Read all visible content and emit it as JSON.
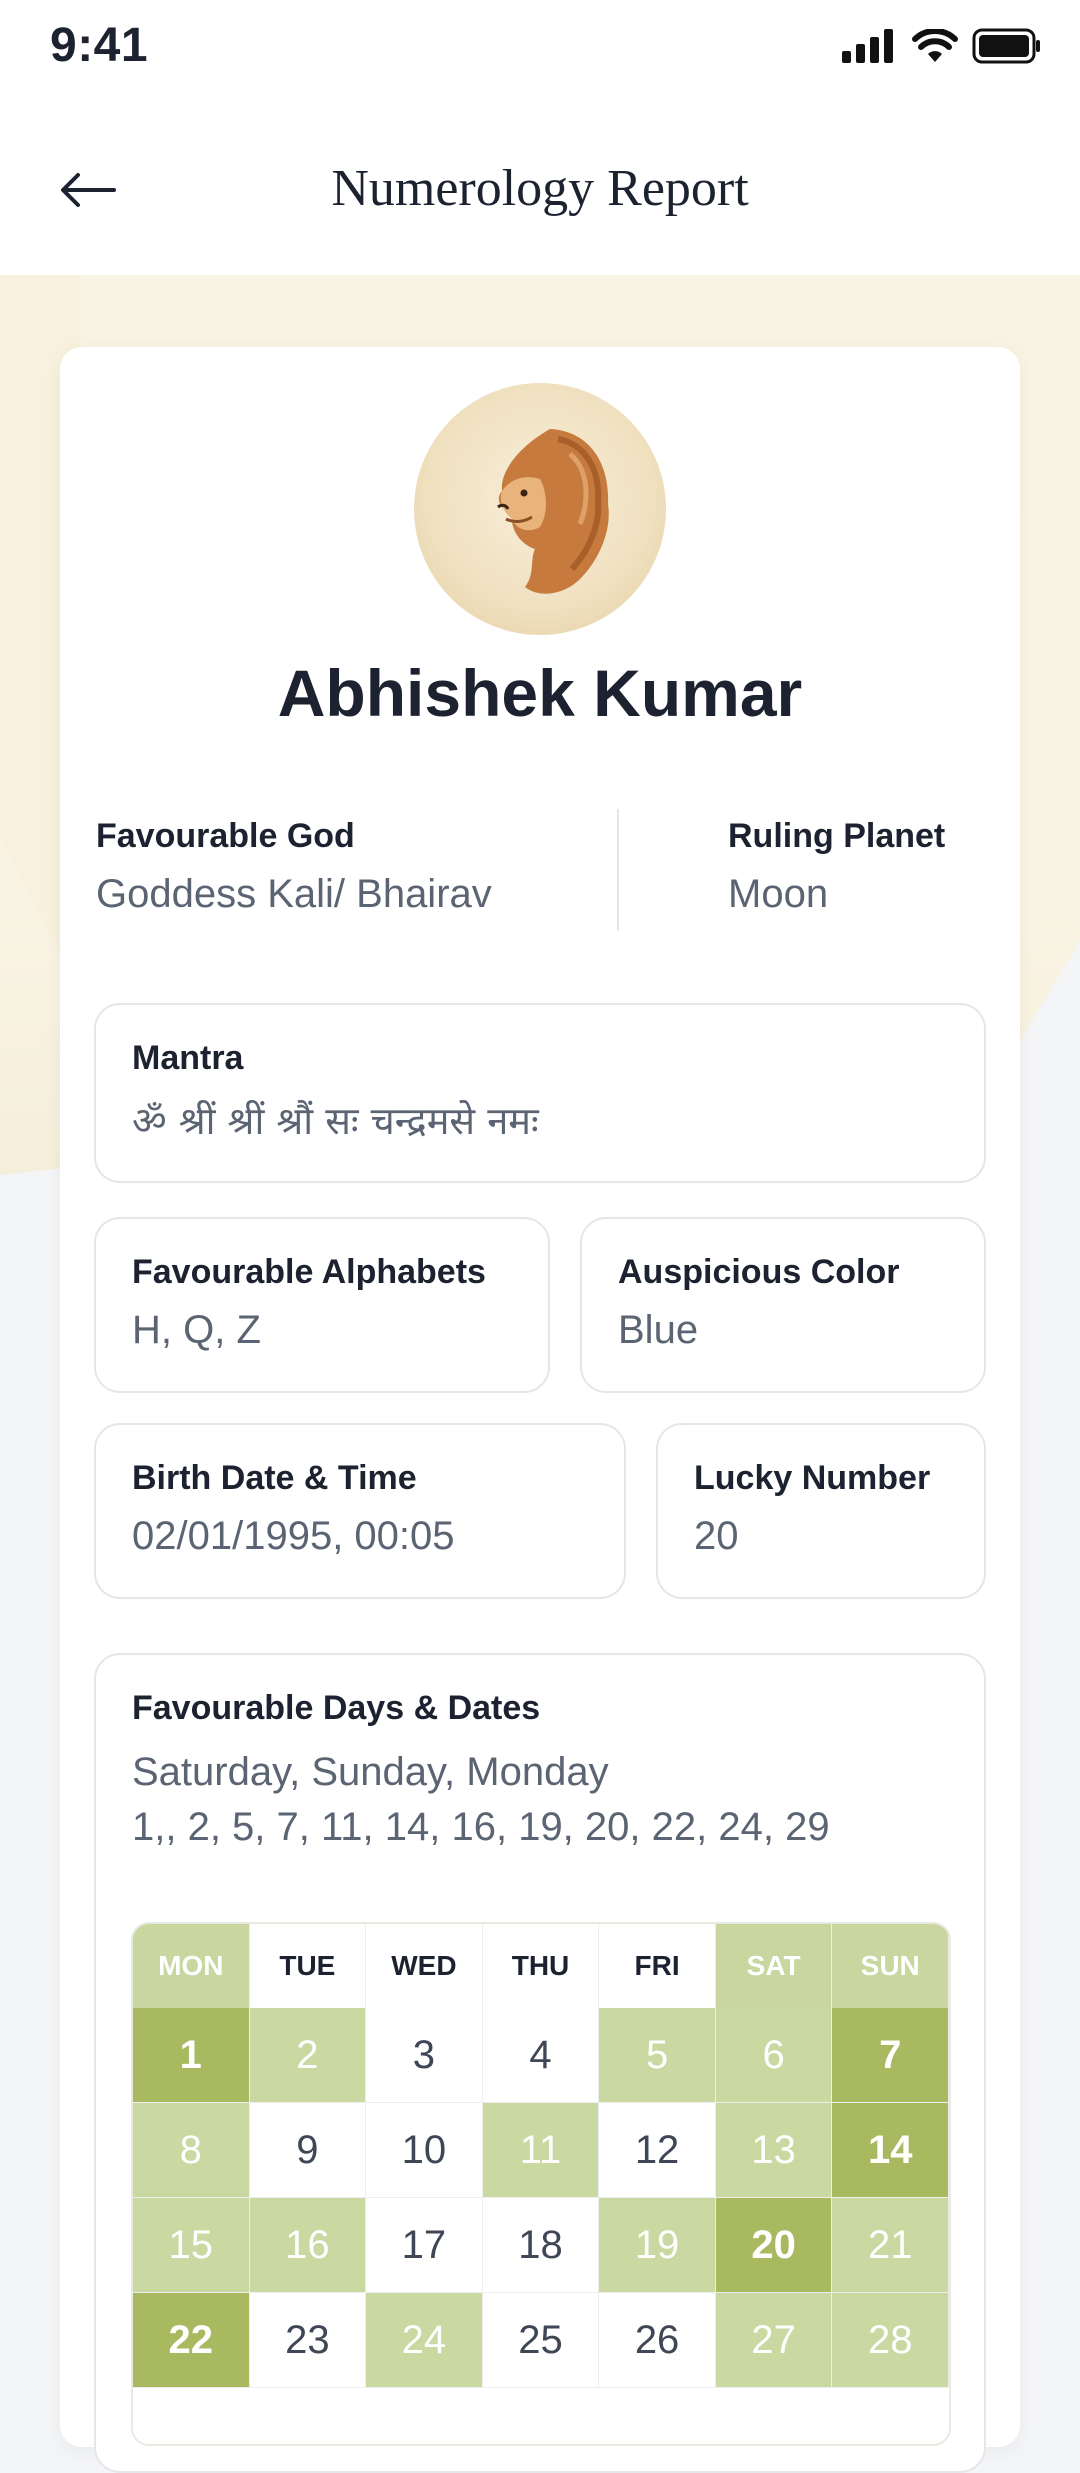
{
  "status": {
    "time": "9:41"
  },
  "header": {
    "title": "Numerology Report",
    "back_icon": "arrow-left-icon"
  },
  "profile": {
    "name": "Abhishek Kumar",
    "avatar_icon": "lion-icon"
  },
  "favourable_god": {
    "label": "Favourable God",
    "value": "Goddess Kali/ Bhairav"
  },
  "ruling_planet": {
    "label": "Ruling Planet",
    "value": "Moon"
  },
  "mantra": {
    "label": "Mantra",
    "value": "ॐ श्रीं श्रीं श्रौं सः चन्द्रमसे नमः"
  },
  "favourable_alphabets": {
    "label": "Favourable Alphabets",
    "value": "H, Q, Z"
  },
  "auspicious_color": {
    "label": "Auspicious Color",
    "value": "Blue"
  },
  "birth": {
    "label": "Birth Date & Time",
    "value": "02/01/1995, 00:05"
  },
  "lucky_number": {
    "label": "Lucky Number",
    "value": "20"
  },
  "favourable_days": {
    "label": "Favourable Days & Dates",
    "days": "Saturday, Sunday, Monday",
    "dates": "1,, 2, 5, 7, 11, 14, 16, 19, 20, 22, 24, 29"
  },
  "calendar": {
    "colors": {
      "light": "#cad8a2",
      "dark": "#a8b960"
    },
    "weekdays": [
      {
        "label": "MON",
        "highlight": true
      },
      {
        "label": "TUE",
        "highlight": false
      },
      {
        "label": "WED",
        "highlight": false
      },
      {
        "label": "THU",
        "highlight": false
      },
      {
        "label": "FRI",
        "highlight": false
      },
      {
        "label": "SAT",
        "highlight": true
      },
      {
        "label": "SUN",
        "highlight": true
      }
    ],
    "days": [
      {
        "n": "1",
        "shade": "dark"
      },
      {
        "n": "2",
        "shade": "light"
      },
      {
        "n": "3",
        "shade": "none"
      },
      {
        "n": "4",
        "shade": "none"
      },
      {
        "n": "5",
        "shade": "light"
      },
      {
        "n": "6",
        "shade": "light"
      },
      {
        "n": "7",
        "shade": "dark"
      },
      {
        "n": "8",
        "shade": "light"
      },
      {
        "n": "9",
        "shade": "none"
      },
      {
        "n": "10",
        "shade": "none"
      },
      {
        "n": "11",
        "shade": "light"
      },
      {
        "n": "12",
        "shade": "none"
      },
      {
        "n": "13",
        "shade": "light"
      },
      {
        "n": "14",
        "shade": "dark"
      },
      {
        "n": "15",
        "shade": "light"
      },
      {
        "n": "16",
        "shade": "light"
      },
      {
        "n": "17",
        "shade": "none"
      },
      {
        "n": "18",
        "shade": "none"
      },
      {
        "n": "19",
        "shade": "light"
      },
      {
        "n": "20",
        "shade": "dark"
      },
      {
        "n": "21",
        "shade": "light"
      },
      {
        "n": "22",
        "shade": "dark"
      },
      {
        "n": "23",
        "shade": "none"
      },
      {
        "n": "24",
        "shade": "light"
      },
      {
        "n": "25",
        "shade": "none"
      },
      {
        "n": "26",
        "shade": "none"
      },
      {
        "n": "27",
        "shade": "light"
      },
      {
        "n": "28",
        "shade": "light"
      }
    ]
  }
}
